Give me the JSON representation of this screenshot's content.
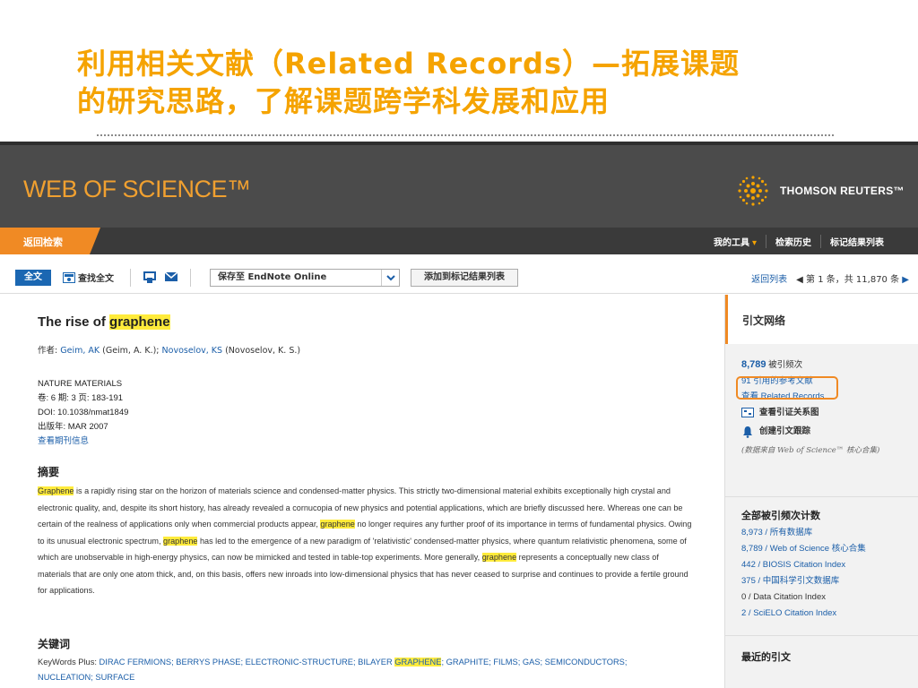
{
  "slide": {
    "title_line1": "利用相关文献（Related Records）—拓展课题",
    "title_line2": "的研究思路，了解课题跨学科发展和应用"
  },
  "header": {
    "logo": "WEB OF SCIENCE™",
    "publisher": "THOMSON REUTERS™"
  },
  "nav": {
    "back": "返回检索",
    "my_tools": "我的工具",
    "history": "检索历史",
    "marked": "标记结果列表"
  },
  "toolbar": {
    "full_text": "全文",
    "find_full_text": "查找全文",
    "save_to": "保存至 EndNote Online",
    "add_to_marked": "添加到标记结果列表",
    "back_to_list": "返回列表",
    "pager": "第 1 条，共 11,870 条"
  },
  "record": {
    "title_prefix": "The rise of ",
    "title_highlight": "graphene",
    "authors_label": "作者: ",
    "author1_link": "Geim, AK",
    "author1_full": " (Geim, A. K.); ",
    "author2_link": "Novoselov, KS",
    "author2_full": " (Novoselov, K. S.)",
    "journal": "NATURE MATERIALS",
    "volume_line": "卷: 6  期: 3  页: 183-191",
    "doi_line": "DOI: 10.1038/nmat1849",
    "date_line": "出版年: MAR 2007",
    "journal_info": "查看期刊信息",
    "abstract_heading": "摘要",
    "abstract_parts": {
      "p1": "Graphene",
      "p2": " is a rapidly rising star on the horizon of materials science and condensed-matter physics. This strictly two-dimensional material exhibits exceptionally high crystal and electronic quality, and, despite its short history, has already revealed a cornucopia of new physics and potential applications, which are briefly discussed here. Whereas one can be certain of the realness of applications only when commercial products appear, ",
      "p3": "graphene",
      "p4": " no longer requires any further proof of its importance in terms of fundamental physics. Owing to its unusual electronic spectrum, ",
      "p5": "graphene",
      "p6": " has led to the emergence of a new paradigm of 'relativistic' condensed-matter physics, where quantum relativistic phenomena, some of which are unobservable in high-energy physics, can now be mimicked and tested in table-top experiments. More generally, ",
      "p7": "graphene",
      "p8": " represents a conceptually new class of materials that are only one atom thick, and, on this basis, offers new inroads into low-dimensional physics that has never ceased to surprise and continues to provide a fertile ground for applications."
    },
    "keywords_heading": "关键词",
    "keywords_a": "KeyWords Plus: ",
    "keywords_b": "DIRAC FERMIONS; BERRYS PHASE; ELECTRONIC-STRUCTURE; BILAYER ",
    "keywords_hl": "GRAPHENE",
    "keywords_c": "; GRAPHITE; FILMS; GAS; SEMICONDUCTORS; NUCLEATION; SURFACE"
  },
  "sidebar": {
    "heading": "引文网络",
    "times_cited_num": "8,789",
    "times_cited_label": " 被引频次",
    "references": "91 引用的参考文献",
    "related": "查看 Related Records",
    "citation_map": "查看引证关系图",
    "create_alert": "创建引文跟踪",
    "note": "(数据来自 Web of Science™ 核心合集)",
    "counts_heading": "全部被引频次计数",
    "counts": [
      "8,973 / 所有数据库",
      "8,789 / Web of Science 核心合集",
      "442 / BIOSIS Citation Index",
      "375 / 中国科学引文数据库",
      "0 / Data Citation Index",
      "2 / SciELO Citation Index"
    ],
    "recent_heading": "最近的引文"
  }
}
